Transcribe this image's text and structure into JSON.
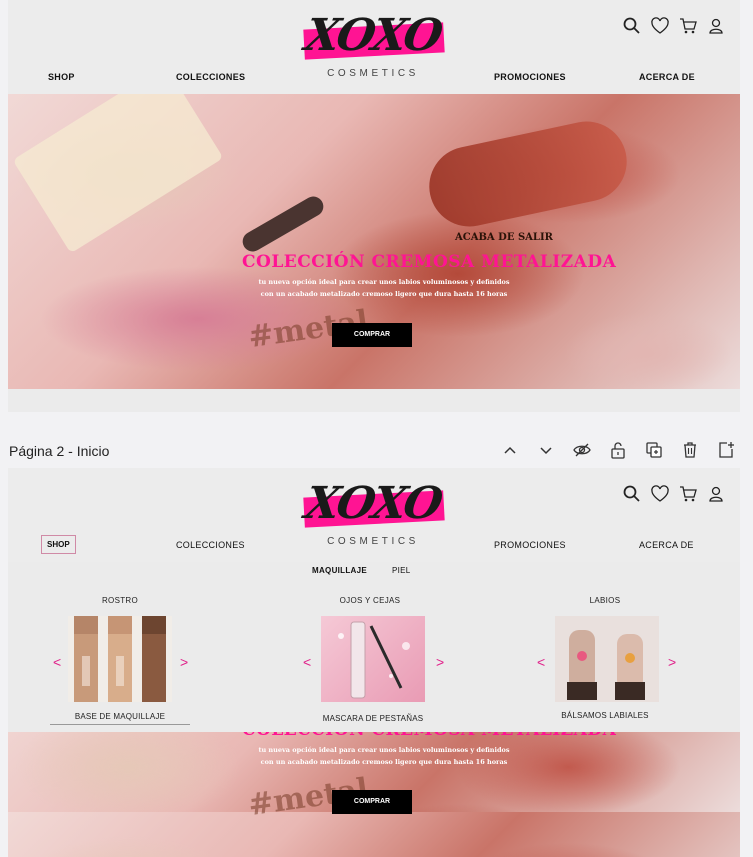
{
  "brand": {
    "logo_main": "XOXO",
    "logo_sub": "COSMETICS",
    "accent": "#ff1493"
  },
  "nav": {
    "shop": "SHOP",
    "colecciones": "COLECCIONES",
    "promociones": "PROMOCIONES",
    "acerca": "ACERCA DE"
  },
  "icons": [
    "search-icon",
    "heart-icon",
    "cart-icon",
    "user-icon"
  ],
  "hero": {
    "tag": "ACABA DE SALIR",
    "title": "COLECCIÓN CREMOSA METALIZADA",
    "desc_line1": "tu nueva opción ideal para crear unos labios voluminosos y definidos",
    "desc_line2": "con un acabado metalizado cremoso ligero que dura hasta 16 horas",
    "cta": "COMPRAR",
    "metal_text": "#metal"
  },
  "editor_bar": {
    "page_title": "Página 2 - Inicio",
    "icons": [
      "chevron-up-icon",
      "chevron-down-icon",
      "hide-icon",
      "lock-icon",
      "duplicate-icon",
      "trash-icon",
      "add-page-icon"
    ]
  },
  "mega_menu": {
    "subnav": {
      "maquillaje": "MAQUILLAJE",
      "piel": "PIEL"
    },
    "columns": [
      {
        "heading": "ROSTRO",
        "product": "BASE DE MAQUILLAJE"
      },
      {
        "heading": "OJOS Y CEJAS",
        "product": "MASCARA DE PESTAÑAS"
      },
      {
        "heading": "LABIOS",
        "product": "BÁLSAMOS LABIALES"
      }
    ],
    "prev_arrow": "<",
    "next_arrow": ">"
  }
}
